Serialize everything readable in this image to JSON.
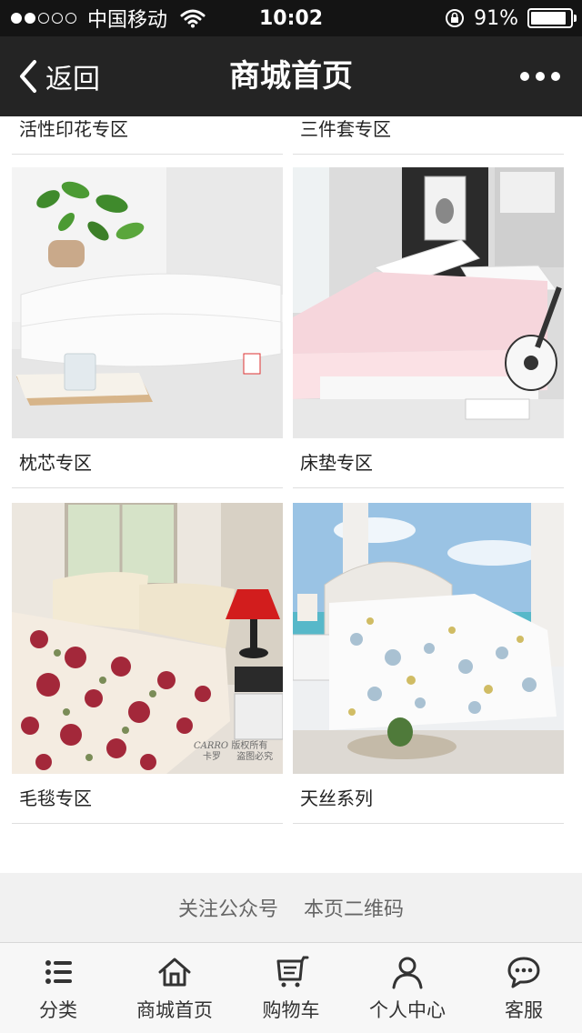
{
  "status_bar": {
    "carrier": "中国移动",
    "time": "10:02",
    "battery": "91%",
    "battery_level": 0.91,
    "signal_bars_filled": 2,
    "signal_bars_total": 5
  },
  "nav": {
    "back_label": "返回",
    "title": "商城首页",
    "more_icon": "more-dots-icon"
  },
  "categories": [
    {
      "label": "活性印花专区",
      "image": "bedding-pattern-image"
    },
    {
      "label": "三件套专区",
      "image": "bedding-set-image"
    },
    {
      "label": "枕芯专区",
      "image": "pillow-image"
    },
    {
      "label": "床垫专区",
      "image": "mattress-image"
    },
    {
      "label": "毛毯专区",
      "image": "blanket-image"
    },
    {
      "label": "天丝系列",
      "image": "tencel-bedding-image"
    }
  ],
  "watermark": {
    "brand": "CARRO",
    "sub": "卡罗",
    "note1": "版权所有",
    "note2": "盗图必究"
  },
  "footer": {
    "follow_label": "关注公众号",
    "qrcode_label": "本页二维码"
  },
  "tabbar": [
    {
      "label": "分类",
      "icon": "list-icon"
    },
    {
      "label": "商城首页",
      "icon": "home-icon"
    },
    {
      "label": "购物车",
      "icon": "cart-icon"
    },
    {
      "label": "个人中心",
      "icon": "person-icon"
    },
    {
      "label": "客服",
      "icon": "chat-icon"
    }
  ],
  "colors": {
    "status_bar_bg": "#141414",
    "nav_bg": "#242424",
    "footer_bg": "#f1f1f1",
    "tabbar_bg": "#f7f7f7"
  }
}
